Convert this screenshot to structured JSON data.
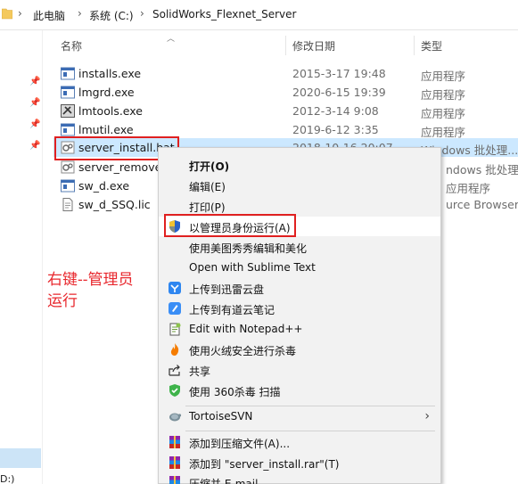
{
  "breadcrumb": {
    "items": [
      "此电脑",
      "系统 (C:)",
      "SolidWorks_Flexnet_Server"
    ],
    "separator": "›"
  },
  "columns": {
    "name": "名称",
    "modified": "修改日期",
    "type": "类型"
  },
  "files": [
    {
      "name": "installs.exe",
      "date": "2015-3-17 19:48",
      "type": "应用程序",
      "icon": "exe-icon"
    },
    {
      "name": "lmgrd.exe",
      "date": "2020-6-15 19:39",
      "type": "应用程序",
      "icon": "exe-icon"
    },
    {
      "name": "lmtools.exe",
      "date": "2012-3-14 9:08",
      "type": "应用程序",
      "icon": "lmtools-icon"
    },
    {
      "name": "lmutil.exe",
      "date": "2019-6-12 3:35",
      "type": "应用程序",
      "icon": "exe-icon"
    },
    {
      "name": "server_install.bat",
      "date": "2018-10-16 20:07",
      "type": "Windows 批处理...",
      "icon": "bat-icon"
    },
    {
      "name": "server_remove.",
      "date": "",
      "type": "ndows 批处理...",
      "icon": "bat-icon"
    },
    {
      "name": "sw_d.exe",
      "date": "",
      "type": "应用程序",
      "icon": "exe-icon"
    },
    {
      "name": "sw_d_SSQ.lic",
      "date": "",
      "type": "urce Browser ...",
      "icon": "lic-icon"
    }
  ],
  "annotation": {
    "line1": "右键--管理员",
    "line2": "运行"
  },
  "nav": {
    "drive": "D:)"
  },
  "context_menu": {
    "items": [
      {
        "label": "打开(O)",
        "bold": true,
        "icon": ""
      },
      {
        "label": "编辑(E)",
        "icon": ""
      },
      {
        "label": "打印(P)",
        "icon": ""
      },
      {
        "label": "以管理员身份运行(A)",
        "icon": "uac-shield-icon"
      },
      {
        "label": "使用美图秀秀编辑和美化",
        "icon": ""
      },
      {
        "label": "Open with Sublime Text",
        "icon": ""
      },
      {
        "label": "上传到迅雷云盘",
        "icon": "xunlei-icon"
      },
      {
        "label": "上传到有道云笔记",
        "icon": "youdao-icon"
      },
      {
        "label": "Edit with Notepad++",
        "icon": "notepad-plus-icon"
      },
      {
        "label": "使用火绒安全进行杀毒",
        "icon": "huorong-icon"
      },
      {
        "label": "共享",
        "icon": "share-icon"
      },
      {
        "label": "使用 360杀毒 扫描",
        "icon": "360-shield-icon"
      },
      {
        "label": "TortoiseSVN",
        "icon": "tortoisesvn-icon"
      },
      {
        "label": "添加到压缩文件(A)...",
        "icon": "winrar-icon"
      },
      {
        "label": "添加到 \"server_install.rar\"(T)",
        "icon": "winrar-icon"
      },
      {
        "label": "压缩并 E-mail...",
        "icon": "winrar-icon"
      }
    ]
  },
  "colors": {
    "highlight": "#cce8ff",
    "annotation_red": "#e8282e",
    "menu_bg": "#f2f2f2"
  }
}
